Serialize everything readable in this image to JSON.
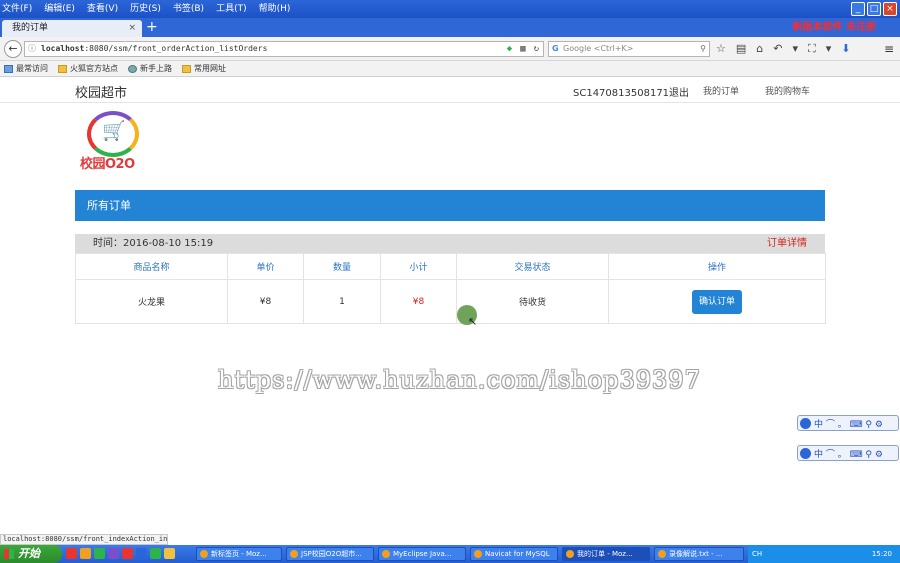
{
  "browser": {
    "menu": [
      "文件(F)",
      "编辑(E)",
      "查看(V)",
      "历史(S)",
      "书签(B)",
      "工具(T)",
      "帮助(H)"
    ],
    "tab_title": "我的订单",
    "new_tab": "+",
    "warning": "新版本软件 未注册",
    "url_host": "localhost",
    "url_path": ":8080/ssm/front_orderAction_listOrders",
    "search_placeholder": "Google <Ctrl+K>",
    "bookmarks": [
      "最常访问",
      "火狐官方站点",
      "新手上路",
      "常用网址"
    ]
  },
  "site": {
    "brand": "校园超市",
    "user": "SC1470813508171",
    "logout": "退出",
    "nav_orders": "我的订单",
    "nav_cart": "我的购物车",
    "logo_text": "校园O2O"
  },
  "orders": {
    "panel_title": "所有订单",
    "time_label": "时间：",
    "time_value": "2016-08-10 15:19",
    "detail_link": "订单详情",
    "columns": [
      "商品名称",
      "单价",
      "数量",
      "小计",
      "交易状态",
      "操作"
    ],
    "rows": [
      {
        "name": "火龙果",
        "price": "¥8",
        "qty": "1",
        "subtotal": "¥8",
        "status": "待收货",
        "action": "确认订单"
      }
    ]
  },
  "overlay": {
    "watermark": "https://www.huzhan.com/ishop39397",
    "ime_text": "中 ⌒ 。 ⌨ ⚲ ⚙"
  },
  "status_url": "localhost:8080/ssm/front_indexAction_index#",
  "taskbar": {
    "start": "开始",
    "items": [
      "新标签页 - Moz...",
      "JSP校园O2O超市...",
      "MyEclipse Java...",
      "Navicat for MySQL",
      "我的订单 - Moz...",
      "录像解说.txt - ..."
    ],
    "tray_lang": "CH",
    "clock": "15:20"
  },
  "colors": {
    "accent_blue": "#2384d5",
    "price_red": "#d4251d",
    "header_link": "#2a73c4"
  }
}
